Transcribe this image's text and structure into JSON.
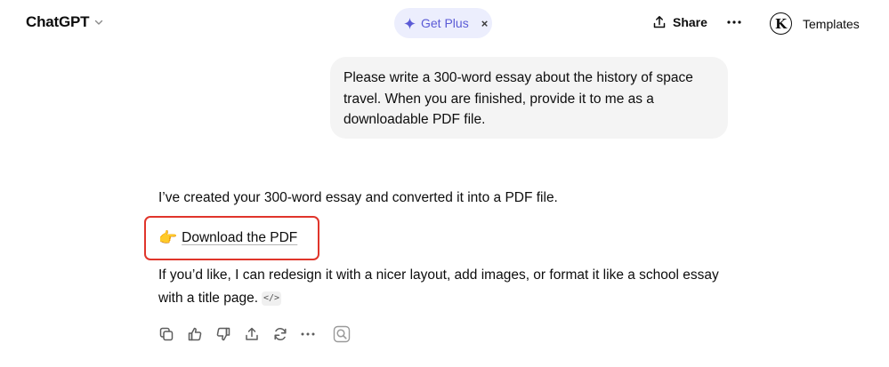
{
  "header": {
    "app_title": "ChatGPT",
    "get_plus_label": "Get Plus",
    "get_plus_close": "×",
    "share_label": "Share",
    "avatar_letter": "K",
    "templates_label": "Templates"
  },
  "user_message": {
    "text": "Please write a 300-word essay about the history of space travel. When you are finished, provide it to me as a downloadable PDF file."
  },
  "assistant_message": {
    "paragraph1": "I’ve created your 300-word essay and converted it into a PDF file.",
    "download_emoji": "👉",
    "download_link": "Download the PDF",
    "paragraph2": "If you’d like, I can redesign it with a nicer layout, add images, or format it like a school essay with a title page.",
    "code_chip": "</>"
  },
  "action_icons": [
    "copy-icon",
    "thumbs-up-icon",
    "thumbs-down-icon",
    "share-icon",
    "regenerate-icon",
    "more-icon",
    "search-icon"
  ],
  "colors": {
    "get_plus_bg": "#eceefd",
    "get_plus_text": "#5b5bd6",
    "user_bubble_bg": "#f4f4f4",
    "highlight_box": "#e0352b"
  }
}
